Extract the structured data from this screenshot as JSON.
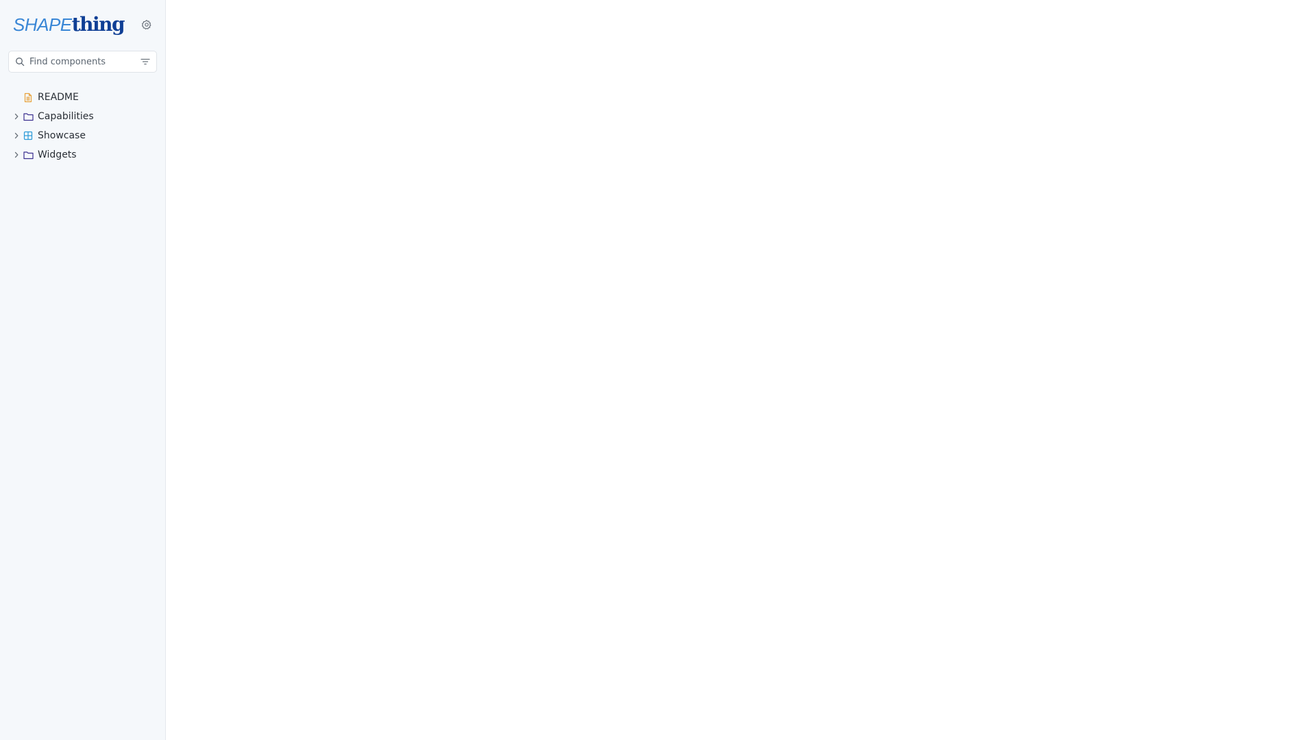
{
  "brand": {
    "logo_part1": "SHAPE",
    "logo_part2": "thing"
  },
  "search": {
    "placeholder": "Find components"
  },
  "tree": [
    {
      "label": "README",
      "icon": "document-icon",
      "expandable": false
    },
    {
      "label": "Capabilities",
      "icon": "folder-icon",
      "expandable": true
    },
    {
      "label": "Showcase",
      "icon": "grid-icon",
      "expandable": true
    },
    {
      "label": "Widgets",
      "icon": "folder-icon",
      "expandable": true
    }
  ],
  "colors": {
    "sidebar_bg": "#f5f8fb",
    "logo_light": "#3a87d6",
    "logo_dark": "#0f3f95",
    "doc_icon": "#e8a23c",
    "folder_icon": "#3b2f8f",
    "grid_icon": "#2a9ad8"
  }
}
